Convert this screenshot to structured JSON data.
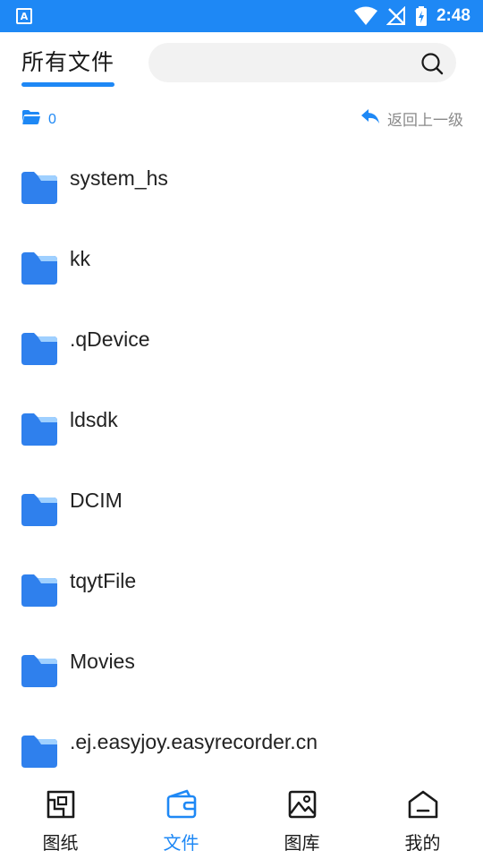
{
  "status_bar": {
    "time": "2:48",
    "app_badge": "A",
    "color": "#1e88f5"
  },
  "header": {
    "title": "所有文件",
    "search": {
      "placeholder": "",
      "value": ""
    }
  },
  "info": {
    "folder_count": "0",
    "back_label": "返回上一级"
  },
  "files": [
    {
      "name": "system_hs"
    },
    {
      "name": "kk"
    },
    {
      "name": ".qDevice"
    },
    {
      "name": "ldsdk"
    },
    {
      "name": "DCIM"
    },
    {
      "name": "tqytFile"
    },
    {
      "name": "Movies"
    },
    {
      "name": ".ej.easyjoy.easyrecorder.cn"
    }
  ],
  "bottom_nav": {
    "items": [
      {
        "label": "图纸",
        "icon": "blueprint-icon",
        "active": false
      },
      {
        "label": "文件",
        "icon": "wallet-icon",
        "active": true
      },
      {
        "label": "图库",
        "icon": "gallery-icon",
        "active": false
      },
      {
        "label": "我的",
        "icon": "home-icon",
        "active": false
      }
    ]
  },
  "colors": {
    "accent": "#1e88f5",
    "folder": "#2f80ed",
    "folder_tab": "#9fd0ff"
  }
}
